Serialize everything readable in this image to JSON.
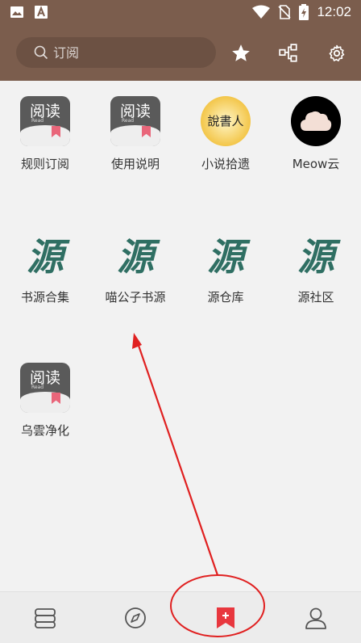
{
  "status_bar": {
    "time": "12:02"
  },
  "toolbar": {
    "search_placeholder": "订阅",
    "icons": [
      "star-icon",
      "share-nodes-icon",
      "gear-icon"
    ]
  },
  "tiles": [
    {
      "label": "规则订阅",
      "icon": "read-app-icon"
    },
    {
      "label": "使用说明",
      "icon": "read-app-icon"
    },
    {
      "label": "小说拾遗",
      "icon": "novel-badge-icon"
    },
    {
      "label": "Meow云",
      "icon": "cloud-icon"
    },
    {
      "label": "书源合集",
      "icon": "yuan-calligraphy-icon"
    },
    {
      "label": "喵公子书源",
      "icon": "yuan-calligraphy-icon"
    },
    {
      "label": "源仓库",
      "icon": "yuan-calligraphy-icon"
    },
    {
      "label": "源社区",
      "icon": "yuan-calligraphy-icon"
    },
    {
      "label": "乌雲净化",
      "icon": "read-app-icon"
    }
  ],
  "read_icon": {
    "title": "阅读",
    "sub": "Read"
  },
  "novel_icon": {
    "text": "說書人"
  },
  "yuan_icon": {
    "glyph": "源"
  },
  "bottom_nav": {
    "items": [
      "bookshelf-icon",
      "compass-icon",
      "subscription-icon",
      "profile-icon"
    ],
    "active_index": 2
  },
  "colors": {
    "toolbar": "#7b5d4d",
    "accent": "#e8373e",
    "annotation": "#e02020"
  }
}
